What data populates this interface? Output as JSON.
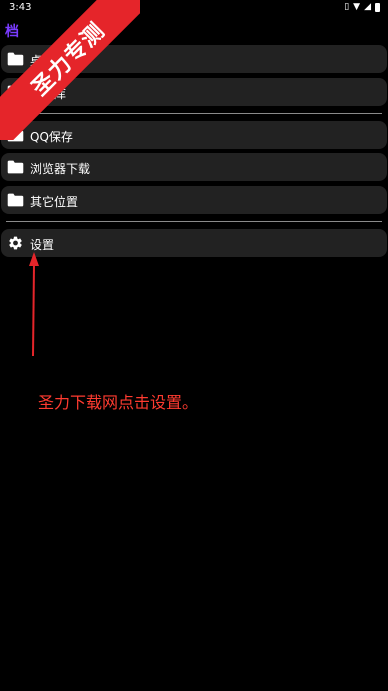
{
  "status_bar": {
    "time": "3:43"
  },
  "app": {
    "title": "档",
    "accent_color": "#7a3cff"
  },
  "menu": {
    "items_group1": [
      {
        "label": "桌表盘",
        "icon": "folder-icon"
      },
      {
        "label": "资料库",
        "icon": "folder-icon"
      }
    ],
    "items_group2": [
      {
        "label": "QQ保存",
        "icon": "folder-icon"
      },
      {
        "label": "浏览器下载",
        "icon": "folder-icon"
      },
      {
        "label": "其它位置",
        "icon": "folder-icon"
      }
    ],
    "settings": {
      "label": "设置",
      "icon": "gear-icon"
    }
  },
  "watermark": {
    "text": "圣力专测",
    "color": "#e5252a"
  },
  "annotation": {
    "text": "圣力下载网点击设置。",
    "color": "#ff3b30"
  }
}
